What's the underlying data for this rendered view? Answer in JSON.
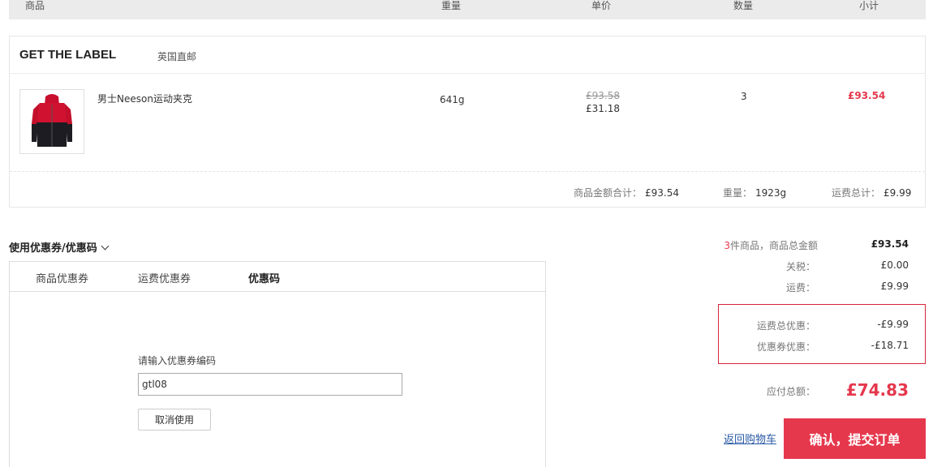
{
  "table_header": {
    "product": "商品",
    "weight": "重量",
    "unit_price": "单价",
    "quantity": "数量",
    "subtotal": "小计"
  },
  "store": {
    "name": "GET THE LABEL",
    "tag": "英国直邮"
  },
  "item": {
    "image_icon": "red-black-jacket",
    "name": "男士Neeson运动夹克",
    "weight": "641g",
    "original_price": "£93.58",
    "price": "£31.18",
    "quantity": "3",
    "subtotal": "£93.54"
  },
  "store_summary": {
    "goods_total_label": "商品金额合计：",
    "goods_total_value": "£93.54",
    "weight_label": "重量：",
    "weight_value": "1923g",
    "shipping_label": "运费总计：",
    "shipping_value": "£9.99"
  },
  "coupon": {
    "title": "使用优惠券/优惠码",
    "tabs": [
      "商品优惠券",
      "运费优惠券",
      "优惠码"
    ],
    "active_tab": 2,
    "input_label": "请输入优惠券编码",
    "input_value": "gtl08",
    "cancel_label": "取消使用"
  },
  "summary": {
    "count": "3",
    "count_label": "件商品，商品总金额",
    "goods_total": "£93.54",
    "tax_label": "关税：",
    "tax_value": "£0.00",
    "shipping_label": "运费：",
    "shipping_value": "£9.99",
    "shipping_discount_label": "运费总优惠：",
    "shipping_discount_value": "-£9.99",
    "coupon_discount_label": "优惠券优惠：",
    "coupon_discount_value": "-£18.71",
    "payable_label": "应付总额：",
    "payable_value": "£74.83"
  },
  "actions": {
    "back_label": "返回购物车",
    "submit_label": "确认，提交订单"
  },
  "colors": {
    "accent": "#e5384d",
    "link": "#2a59a6"
  }
}
